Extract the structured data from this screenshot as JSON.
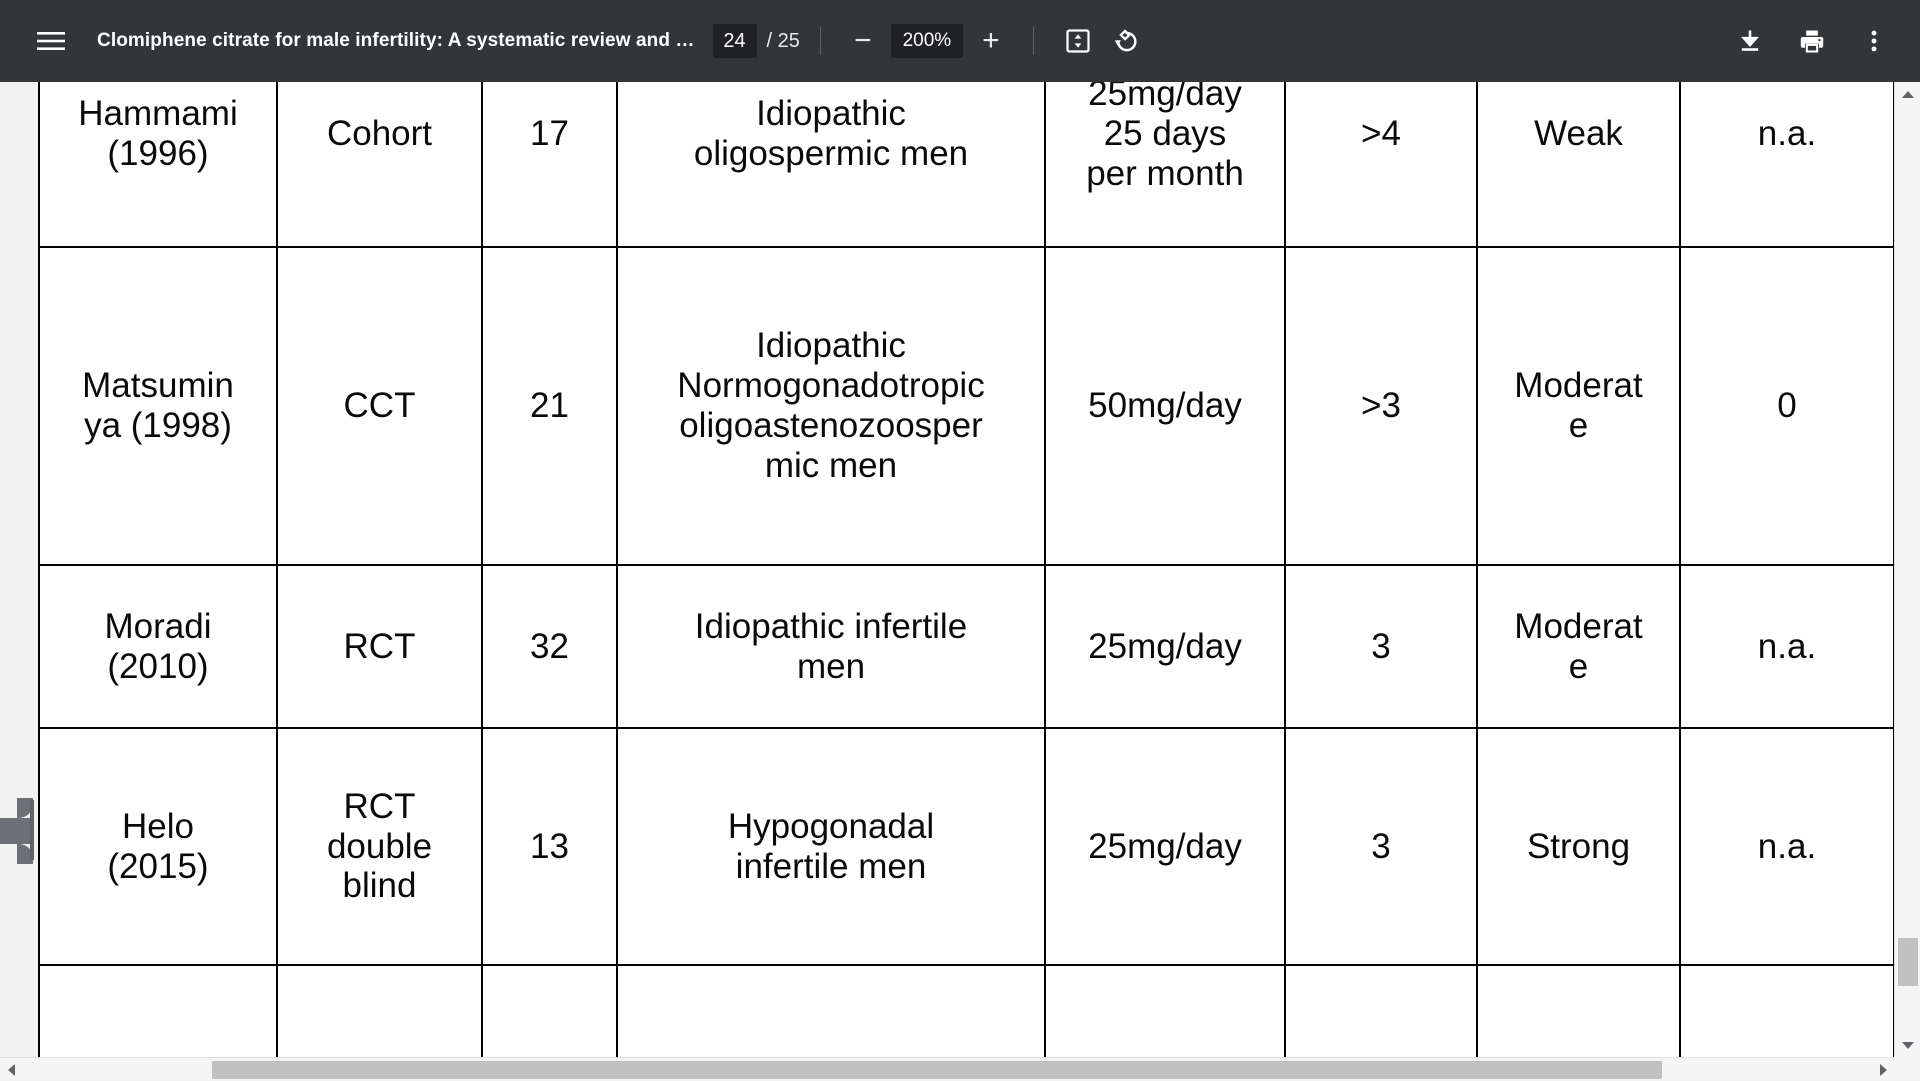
{
  "toolbar": {
    "menu_icon": "hamburger-menu-icon",
    "document_title": "Clomiphene citrate for male infertility: A systematic review and …",
    "page_current": "24",
    "page_total": "/ 25",
    "zoom_out_label": "−",
    "zoom_level": "200%",
    "zoom_in_label": "+",
    "fit_icon": "fit-to-page-icon",
    "rotate_icon": "rotate-counterclockwise-icon",
    "download_icon": "download-icon",
    "print_icon": "print-icon",
    "more_icon": "more-options-icon",
    "background_color": "#323639",
    "field_background_color": "#202124"
  },
  "viewer": {
    "left_handle_name": "sidebar-drag-handle",
    "vertical_scrollbar": {
      "up_arrow": "scroll-up-arrow",
      "down_arrow": "scroll-down-arrow"
    },
    "horizontal_scrollbar": {
      "left_arrow": "scroll-left-arrow",
      "right_arrow": "scroll-right-arrow"
    }
  },
  "table": {
    "columns": 8,
    "rows": [
      {
        "name": "Hammami\n(1996)",
        "design": "Cohort",
        "n": "17",
        "population": "Idiopathic\noligospermic men",
        "dose": "25mg/day\n25 days\nper month",
        "duration": ">4",
        "evidence": "Weak",
        "last": "n.a."
      },
      {
        "name": "Matsumin\nya (1998)",
        "design": "CCT",
        "n": "21",
        "population": "Idiopathic\nNormogonadotropic\noligoastenozoosper\nmic men",
        "dose": "50mg/day",
        "duration": ">3",
        "evidence": "Moderat\ne",
        "last": "0"
      },
      {
        "name": "Moradi\n(2010)",
        "design": "RCT",
        "n": "32",
        "population": "Idiopathic infertile\nmen",
        "dose": "25mg/day",
        "duration": "3",
        "evidence": "Moderat\ne",
        "last": "n.a."
      },
      {
        "name": "Helo\n(2015)",
        "design": "RCT\ndouble\nblind",
        "n": "13",
        "population": "Hypogonadal\ninfertile men",
        "dose": "25mg/day",
        "duration": "3",
        "evidence": "Strong",
        "last": "n.a."
      },
      {
        "name": "",
        "design": "",
        "n": "",
        "population": "",
        "dose": "",
        "duration": "",
        "evidence": "",
        "last": ""
      }
    ]
  }
}
